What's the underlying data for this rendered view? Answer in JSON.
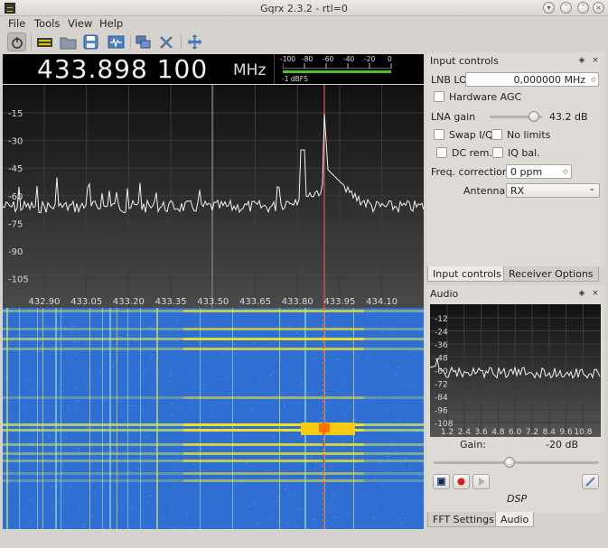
{
  "window": {
    "title": "Gqrx 2.3.2 - rtl=0"
  },
  "menu": {
    "file": "File",
    "tools": "Tools",
    "view": "View",
    "help": "Help"
  },
  "frequency": {
    "value": "433.898 100",
    "unit": "MHz"
  },
  "meter": {
    "scale": [
      "-100",
      "-80",
      "-60",
      "-40",
      "-20",
      "0"
    ],
    "label": "-1 dBFS"
  },
  "fft": {
    "db_ticks": [
      "-15",
      "-30",
      "-45",
      "-60",
      "-75",
      "-90",
      "-105"
    ],
    "freq_ticks": [
      "432.90",
      "433.05",
      "433.20",
      "433.35",
      "433.50",
      "433.65",
      "433.80",
      "433.95",
      "434.10"
    ]
  },
  "input_controls": {
    "title": "Input controls",
    "lnb_lo_label": "LNB LO",
    "lnb_lo_value": "0,000000 MHz",
    "hardware_agc": "Hardware AGC",
    "lna_gain_label": "LNA gain",
    "lna_gain_value": "43.2 dB",
    "swap_iq": "Swap I/Q",
    "no_limits": "No limits",
    "dc_rem": "DC rem.",
    "iq_bal": "IQ bal.",
    "freq_corr_label": "Freq. correction",
    "freq_corr_value": "0 ppm",
    "antenna_label": "Antenna",
    "antenna_value": "RX"
  },
  "top_tabs": {
    "input_controls": "Input controls",
    "receiver_options": "Receiver Options"
  },
  "audio": {
    "title": "Audio",
    "db_ticks": [
      "-12",
      "-24",
      "-36",
      "-48",
      "-60",
      "-72",
      "-84",
      "-96",
      "-108"
    ],
    "freq_ticks": [
      "1.2",
      "2.4",
      "3.6",
      "4.8",
      "6.0",
      "7.2",
      "8.4",
      "9.6",
      "10.8"
    ],
    "gain_label": "Gain:",
    "gain_value": "-20 dB",
    "dsp_label": "DSP"
  },
  "bottom_tabs": {
    "fft_settings": "FFT Settings",
    "audio": "Audio"
  }
}
